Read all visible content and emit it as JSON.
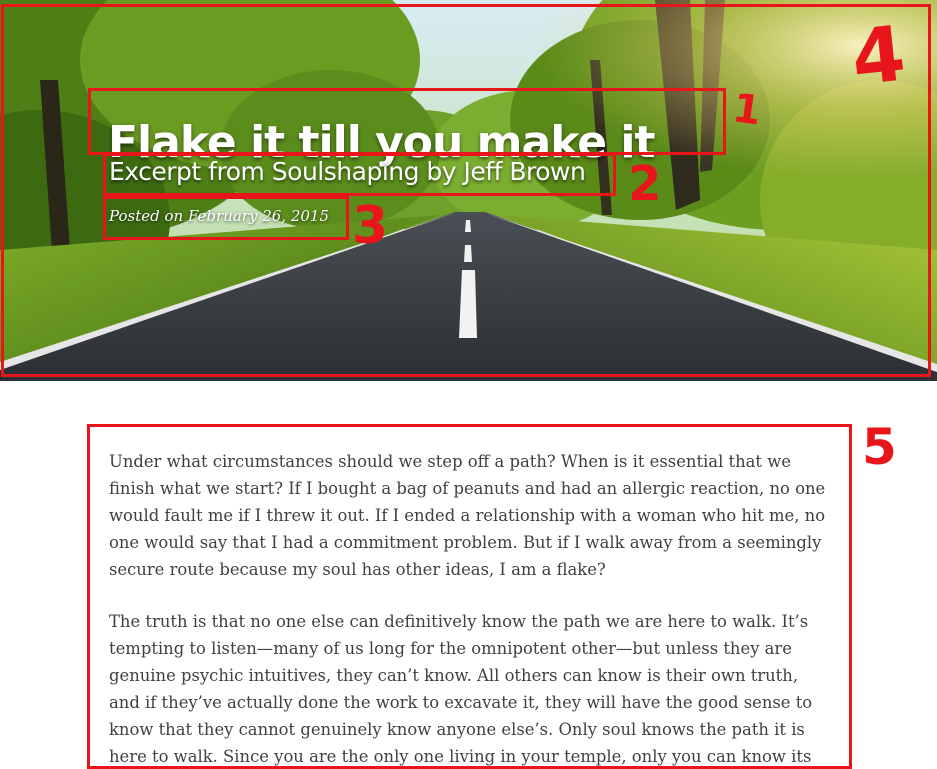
{
  "post": {
    "title": "Flake it till you make it",
    "subtitle": "Excerpt from Soulshaping by Jeff Brown",
    "meta": "Posted on February 26, 2015"
  },
  "annotations": {
    "marker_1": "1",
    "marker_2": "2",
    "marker_3": "3",
    "marker_4": "4",
    "marker_5": "5",
    "color": "#e8161a"
  },
  "body": {
    "paragraphs": [
      "Under what circumstances should we step off a path? When is it essential that we finish what we start? If I bought a bag of peanuts and had an allergic reaction, no one would fault me if I threw it out. If I ended a relationship with a woman who hit me, no one would say that I had a commitment problem. But if I walk away from a seemingly secure route because my soul has other ideas, I am a flake?",
      "The truth is that no one else can definitively know the path we are here to walk. It’s tempting to listen—many of us long for the omnipotent other—but unless they are genuine psychic intuitives, they can’t know. All others can know is their own truth, and if they’ve actually done the work to excavate it, they will have the good sense to know that they cannot genuinely know anyone else’s. Only soul knows the path it is here to walk. Since you are the only one living in your temple, only you can know its"
    ]
  },
  "theme": {
    "text_color": "#404040",
    "title_color": "#ffffff",
    "annotation_color": "#e8161a"
  }
}
